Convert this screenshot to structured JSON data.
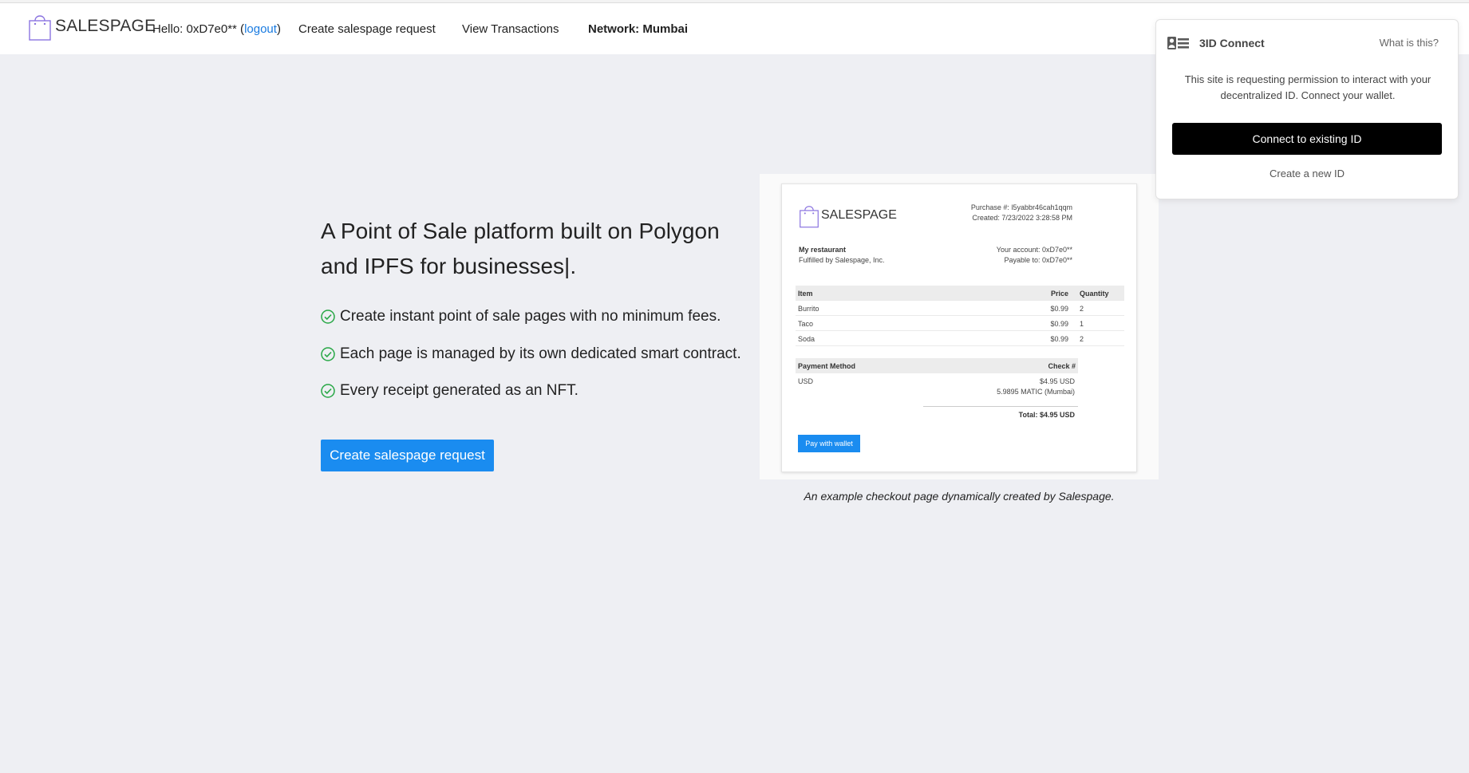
{
  "navbar": {
    "brand": "SALESPAGE",
    "hello_prefix": "Hello: 0xD7e0** (",
    "logout": "logout",
    "hello_suffix": ")",
    "create_request": "Create salespage request",
    "view_transactions": "View Transactions",
    "network": "Network: Mumbai"
  },
  "hero": {
    "title": "A Point of Sale platform built on Polygon and IPFS for businesses|.",
    "features": [
      "Create instant point of sale pages with no minimum fees.",
      "Each page is managed by its own dedicated smart contract.",
      "Every receipt generated as an NFT."
    ],
    "cta": "Create salespage request"
  },
  "preview": {
    "brand": "SALESPAGE",
    "purchase": "Purchase #: l5yabbr46cah1qqm",
    "created": "Created: 7/23/2022 3:28:58 PM",
    "store_name": "My restaurant",
    "fulfilled": "Fulfilled by Salespage, Inc.",
    "your_account": "Your account: 0xD7e0**",
    "payable_to": "Payable to: 0xD7e0**",
    "columns": {
      "item": "Item",
      "price": "Price",
      "quantity": "Quantity"
    },
    "items": [
      {
        "name": "Burrito",
        "price": "$0.99",
        "qty": "2"
      },
      {
        "name": "Taco",
        "price": "$0.99",
        "qty": "1"
      },
      {
        "name": "Soda",
        "price": "$0.99",
        "qty": "2"
      }
    ],
    "payment_method_label": "Payment Method",
    "check_label": "Check #",
    "payment_method": "USD",
    "amount_usd": "$4.95 USD",
    "amount_matic": "5.9895 MATIC (Mumbai)",
    "total": "Total: $4.95 USD",
    "pay_button": "Pay with wallet",
    "caption": "An example checkout page dynamically created by Salespage."
  },
  "popup": {
    "title": "3ID Connect",
    "what": "What is this?",
    "body": "This site is requesting permission to interact with your decentralized ID. Connect your wallet.",
    "connect": "Connect to existing ID",
    "create": "Create a new ID"
  },
  "colors": {
    "accent": "#1a8cf0",
    "link": "#1a7be0",
    "brand_purple": "#8b74e0",
    "check_green": "#27a745"
  }
}
